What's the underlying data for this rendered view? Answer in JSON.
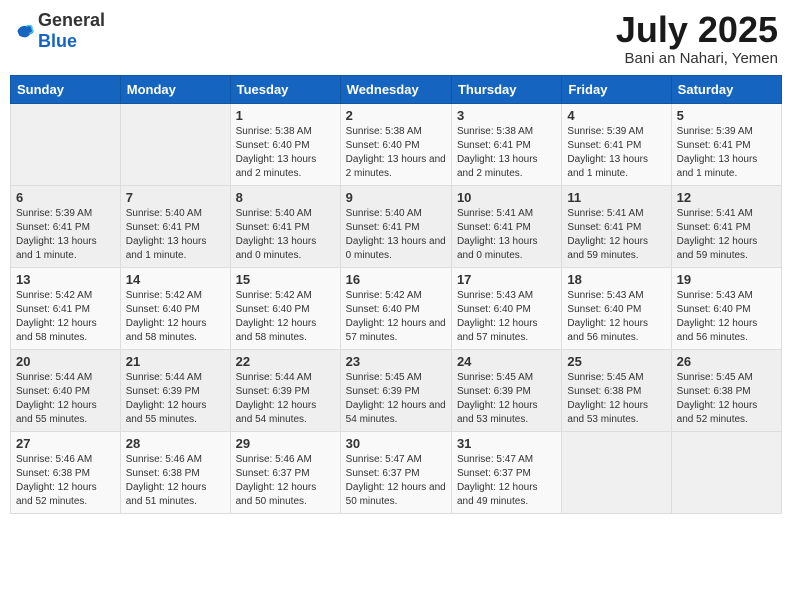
{
  "logo": {
    "general": "General",
    "blue": "Blue"
  },
  "header": {
    "month": "July 2025",
    "location": "Bani an Nahari, Yemen"
  },
  "weekdays": [
    "Sunday",
    "Monday",
    "Tuesday",
    "Wednesday",
    "Thursday",
    "Friday",
    "Saturday"
  ],
  "weeks": [
    [
      {
        "day": "",
        "sunrise": "",
        "sunset": "",
        "daylight": ""
      },
      {
        "day": "",
        "sunrise": "",
        "sunset": "",
        "daylight": ""
      },
      {
        "day": "1",
        "sunrise": "Sunrise: 5:38 AM",
        "sunset": "Sunset: 6:40 PM",
        "daylight": "Daylight: 13 hours and 2 minutes."
      },
      {
        "day": "2",
        "sunrise": "Sunrise: 5:38 AM",
        "sunset": "Sunset: 6:40 PM",
        "daylight": "Daylight: 13 hours and 2 minutes."
      },
      {
        "day": "3",
        "sunrise": "Sunrise: 5:38 AM",
        "sunset": "Sunset: 6:41 PM",
        "daylight": "Daylight: 13 hours and 2 minutes."
      },
      {
        "day": "4",
        "sunrise": "Sunrise: 5:39 AM",
        "sunset": "Sunset: 6:41 PM",
        "daylight": "Daylight: 13 hours and 1 minute."
      },
      {
        "day": "5",
        "sunrise": "Sunrise: 5:39 AM",
        "sunset": "Sunset: 6:41 PM",
        "daylight": "Daylight: 13 hours and 1 minute."
      }
    ],
    [
      {
        "day": "6",
        "sunrise": "Sunrise: 5:39 AM",
        "sunset": "Sunset: 6:41 PM",
        "daylight": "Daylight: 13 hours and 1 minute."
      },
      {
        "day": "7",
        "sunrise": "Sunrise: 5:40 AM",
        "sunset": "Sunset: 6:41 PM",
        "daylight": "Daylight: 13 hours and 1 minute."
      },
      {
        "day": "8",
        "sunrise": "Sunrise: 5:40 AM",
        "sunset": "Sunset: 6:41 PM",
        "daylight": "Daylight: 13 hours and 0 minutes."
      },
      {
        "day": "9",
        "sunrise": "Sunrise: 5:40 AM",
        "sunset": "Sunset: 6:41 PM",
        "daylight": "Daylight: 13 hours and 0 minutes."
      },
      {
        "day": "10",
        "sunrise": "Sunrise: 5:41 AM",
        "sunset": "Sunset: 6:41 PM",
        "daylight": "Daylight: 13 hours and 0 minutes."
      },
      {
        "day": "11",
        "sunrise": "Sunrise: 5:41 AM",
        "sunset": "Sunset: 6:41 PM",
        "daylight": "Daylight: 12 hours and 59 minutes."
      },
      {
        "day": "12",
        "sunrise": "Sunrise: 5:41 AM",
        "sunset": "Sunset: 6:41 PM",
        "daylight": "Daylight: 12 hours and 59 minutes."
      }
    ],
    [
      {
        "day": "13",
        "sunrise": "Sunrise: 5:42 AM",
        "sunset": "Sunset: 6:41 PM",
        "daylight": "Daylight: 12 hours and 58 minutes."
      },
      {
        "day": "14",
        "sunrise": "Sunrise: 5:42 AM",
        "sunset": "Sunset: 6:40 PM",
        "daylight": "Daylight: 12 hours and 58 minutes."
      },
      {
        "day": "15",
        "sunrise": "Sunrise: 5:42 AM",
        "sunset": "Sunset: 6:40 PM",
        "daylight": "Daylight: 12 hours and 58 minutes."
      },
      {
        "day": "16",
        "sunrise": "Sunrise: 5:42 AM",
        "sunset": "Sunset: 6:40 PM",
        "daylight": "Daylight: 12 hours and 57 minutes."
      },
      {
        "day": "17",
        "sunrise": "Sunrise: 5:43 AM",
        "sunset": "Sunset: 6:40 PM",
        "daylight": "Daylight: 12 hours and 57 minutes."
      },
      {
        "day": "18",
        "sunrise": "Sunrise: 5:43 AM",
        "sunset": "Sunset: 6:40 PM",
        "daylight": "Daylight: 12 hours and 56 minutes."
      },
      {
        "day": "19",
        "sunrise": "Sunrise: 5:43 AM",
        "sunset": "Sunset: 6:40 PM",
        "daylight": "Daylight: 12 hours and 56 minutes."
      }
    ],
    [
      {
        "day": "20",
        "sunrise": "Sunrise: 5:44 AM",
        "sunset": "Sunset: 6:40 PM",
        "daylight": "Daylight: 12 hours and 55 minutes."
      },
      {
        "day": "21",
        "sunrise": "Sunrise: 5:44 AM",
        "sunset": "Sunset: 6:39 PM",
        "daylight": "Daylight: 12 hours and 55 minutes."
      },
      {
        "day": "22",
        "sunrise": "Sunrise: 5:44 AM",
        "sunset": "Sunset: 6:39 PM",
        "daylight": "Daylight: 12 hours and 54 minutes."
      },
      {
        "day": "23",
        "sunrise": "Sunrise: 5:45 AM",
        "sunset": "Sunset: 6:39 PM",
        "daylight": "Daylight: 12 hours and 54 minutes."
      },
      {
        "day": "24",
        "sunrise": "Sunrise: 5:45 AM",
        "sunset": "Sunset: 6:39 PM",
        "daylight": "Daylight: 12 hours and 53 minutes."
      },
      {
        "day": "25",
        "sunrise": "Sunrise: 5:45 AM",
        "sunset": "Sunset: 6:38 PM",
        "daylight": "Daylight: 12 hours and 53 minutes."
      },
      {
        "day": "26",
        "sunrise": "Sunrise: 5:45 AM",
        "sunset": "Sunset: 6:38 PM",
        "daylight": "Daylight: 12 hours and 52 minutes."
      }
    ],
    [
      {
        "day": "27",
        "sunrise": "Sunrise: 5:46 AM",
        "sunset": "Sunset: 6:38 PM",
        "daylight": "Daylight: 12 hours and 52 minutes."
      },
      {
        "day": "28",
        "sunrise": "Sunrise: 5:46 AM",
        "sunset": "Sunset: 6:38 PM",
        "daylight": "Daylight: 12 hours and 51 minutes."
      },
      {
        "day": "29",
        "sunrise": "Sunrise: 5:46 AM",
        "sunset": "Sunset: 6:37 PM",
        "daylight": "Daylight: 12 hours and 50 minutes."
      },
      {
        "day": "30",
        "sunrise": "Sunrise: 5:47 AM",
        "sunset": "Sunset: 6:37 PM",
        "daylight": "Daylight: 12 hours and 50 minutes."
      },
      {
        "day": "31",
        "sunrise": "Sunrise: 5:47 AM",
        "sunset": "Sunset: 6:37 PM",
        "daylight": "Daylight: 12 hours and 49 minutes."
      },
      {
        "day": "",
        "sunrise": "",
        "sunset": "",
        "daylight": ""
      },
      {
        "day": "",
        "sunrise": "",
        "sunset": "",
        "daylight": ""
      }
    ]
  ]
}
